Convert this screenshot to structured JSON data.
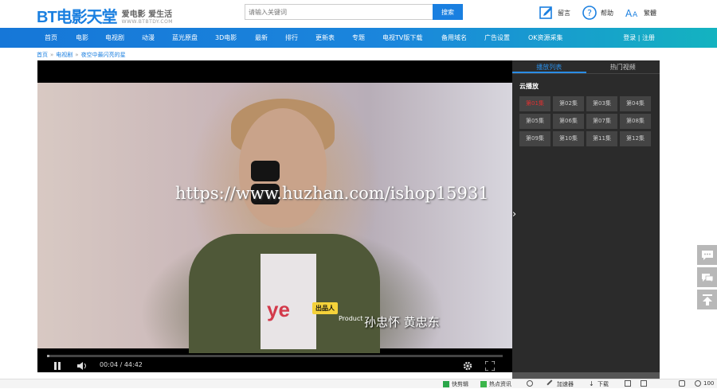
{
  "header": {
    "logo_main": "BT电影天堂",
    "logo_slogan": "爱电影 爱生活",
    "logo_url": "WWW.BTBTDY.COM",
    "search_placeholder": "请输入关键词",
    "search_button": "搜索",
    "tools": [
      {
        "icon": "edit-icon",
        "label": "留言"
      },
      {
        "icon": "help-icon",
        "label": "帮助"
      },
      {
        "icon": "font-icon",
        "label": "繁體"
      }
    ]
  },
  "nav": {
    "items": [
      "首页",
      "电影",
      "电视剧",
      "动漫",
      "蓝光原盘",
      "3D电影",
      "最新",
      "排行",
      "更新表",
      "专题",
      "电视TV版下载",
      "备用域名",
      "广告设置",
      "OK资源采集"
    ],
    "login": "登录",
    "sep": "|",
    "register": "注册"
  },
  "breadcrumb": {
    "items": [
      "首页",
      "电视剧",
      "夜空中最闪亮的星"
    ]
  },
  "player": {
    "watermark": "https://www.huzhan.com/ishop15931",
    "subtitle_badge": "出品人",
    "subtitle_badge_sub": "Product",
    "subtitle": "孙忠怀 黄忠东",
    "shirt_text": "ye",
    "current_time": "00:04",
    "time_sep": " / ",
    "duration": "44:42",
    "progress": 0.0015
  },
  "side": {
    "tabs": [
      "播放列表",
      "热门视频"
    ],
    "source": "云播放",
    "episodes": [
      "第01集",
      "第02集",
      "第03集",
      "第04集",
      "第05集",
      "第06集",
      "第07集",
      "第08集",
      "第09集",
      "第10集",
      "第11集",
      "第12集"
    ],
    "active_episode": 0,
    "arrow": "›"
  },
  "statusbar": [
    {
      "icon": "video-icon",
      "label": "快剪辑"
    },
    {
      "icon": "news-icon",
      "label": "热点资讯"
    },
    {
      "icon": "swirl-icon",
      "label": ""
    },
    {
      "icon": "rocket-icon",
      "label": "加速器"
    },
    {
      "icon": "download-icon",
      "label": "下载"
    },
    {
      "icon": "page-icon",
      "label": ""
    },
    {
      "icon": "sound-icon",
      "label": ""
    },
    {
      "icon": "zoom-icon",
      "label": "100"
    }
  ],
  "colors": {
    "brand": "#1a7fe0",
    "nav_start": "#1677d8",
    "nav_end": "#14b3c0",
    "active_episode": "#e03030",
    "panel_bg": "#2b2b2b"
  }
}
